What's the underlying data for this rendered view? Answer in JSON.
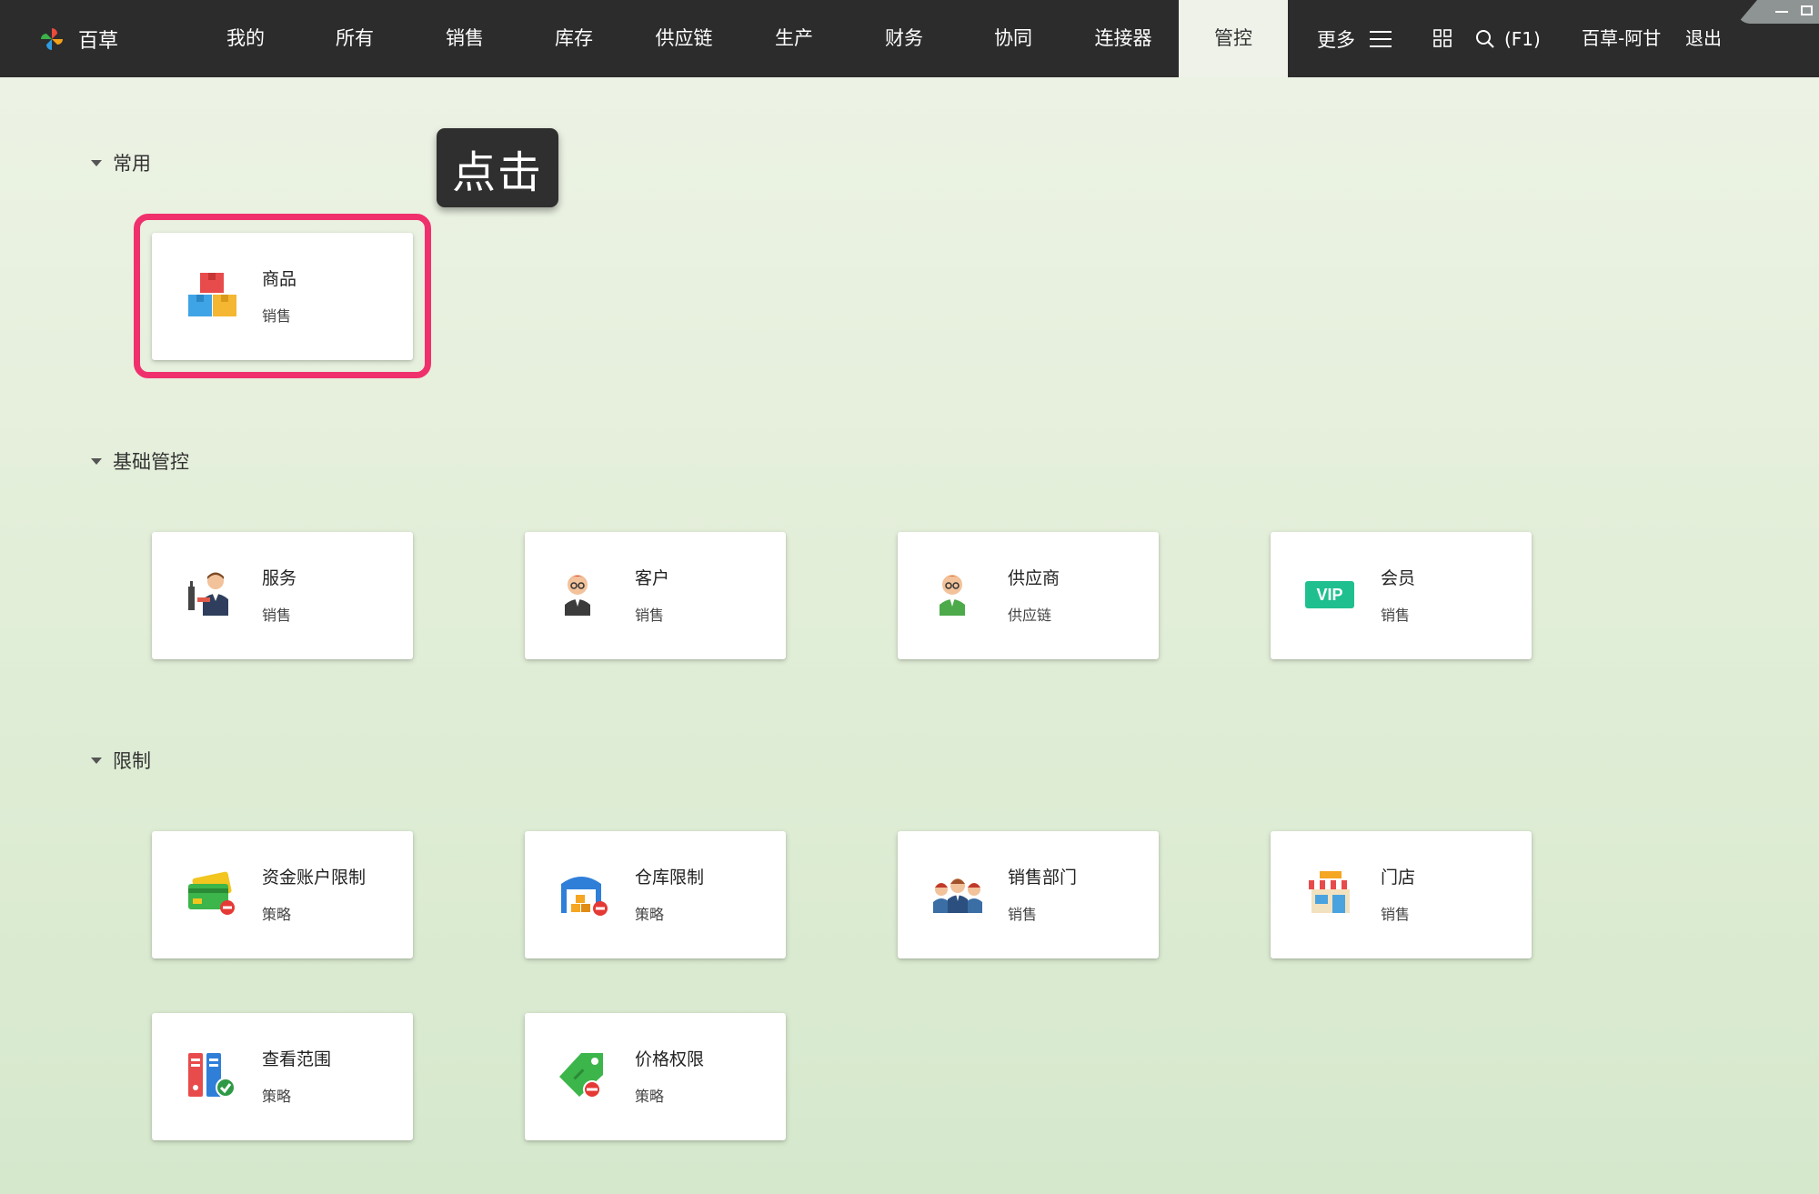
{
  "app": {
    "brand": "百草"
  },
  "nav": {
    "items": [
      {
        "label": "我的"
      },
      {
        "label": "所有"
      },
      {
        "label": "销售"
      },
      {
        "label": "库存"
      },
      {
        "label": "供应链"
      },
      {
        "label": "生产"
      },
      {
        "label": "财务"
      },
      {
        "label": "协同"
      },
      {
        "label": "连接器"
      },
      {
        "label": "管控",
        "active": true
      }
    ],
    "more_label": "更多",
    "search_label": "(F1)",
    "user_label": "百草-阿甘",
    "logout_label": "退出"
  },
  "tooltip": {
    "text": "点击"
  },
  "sections": {
    "common": {
      "title": "常用",
      "cards": [
        {
          "name": "商品",
          "sub": "销售",
          "icon": "boxes-icon"
        }
      ]
    },
    "basic": {
      "title": "基础管控",
      "cards": [
        {
          "name": "服务",
          "sub": "销售",
          "icon": "waiter-icon"
        },
        {
          "name": "客户",
          "sub": "销售",
          "icon": "customer-icon"
        },
        {
          "name": "供应商",
          "sub": "供应链",
          "icon": "supplier-icon"
        },
        {
          "name": "会员",
          "sub": "销售",
          "icon": "vip-icon",
          "badge": "VIP"
        }
      ]
    },
    "limit": {
      "title": "限制",
      "cards": [
        {
          "name": "资金账户限制",
          "sub": "策略",
          "icon": "credit-card-icon"
        },
        {
          "name": "仓库限制",
          "sub": "策略",
          "icon": "warehouse-icon"
        },
        {
          "name": "销售部门",
          "sub": "销售",
          "icon": "team-icon"
        },
        {
          "name": "门店",
          "sub": "销售",
          "icon": "shop-icon"
        },
        {
          "name": "查看范围",
          "sub": "策略",
          "icon": "binders-icon"
        },
        {
          "name": "价格权限",
          "sub": "策略",
          "icon": "price-tag-icon"
        }
      ]
    }
  },
  "colors": {
    "highlight": "#f0306c",
    "topbar": "#2c2c2c",
    "vip": "#1fbf8f"
  }
}
